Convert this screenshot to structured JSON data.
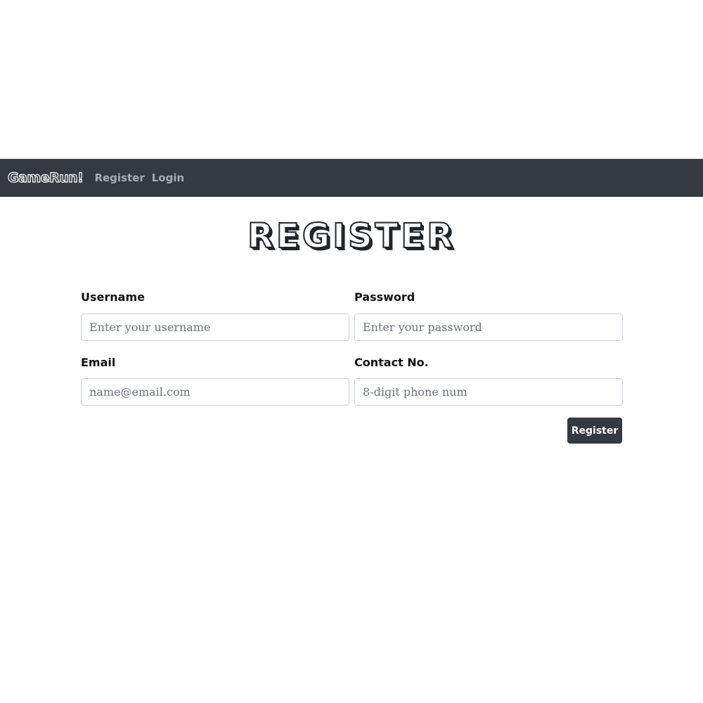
{
  "navbar": {
    "brand": "GameRun!",
    "links": [
      {
        "label": "Register"
      },
      {
        "label": "Login"
      }
    ]
  },
  "page_title": "REGISTER",
  "form": {
    "username": {
      "label": "Username",
      "placeholder": "Enter your username",
      "value": ""
    },
    "password": {
      "label": "Password",
      "placeholder": "Enter your password",
      "value": ""
    },
    "email": {
      "label": "Email",
      "placeholder": "name@email.com",
      "value": ""
    },
    "contact": {
      "label": "Contact No.",
      "placeholder": "8-digit phone num",
      "value": ""
    },
    "submit_label": "Register"
  },
  "colors": {
    "navbar_bg": "#343a40",
    "nav_link": "#a9adb1",
    "button_bg": "#343a40",
    "input_border": "#ced4da",
    "placeholder": "#6c757d"
  }
}
